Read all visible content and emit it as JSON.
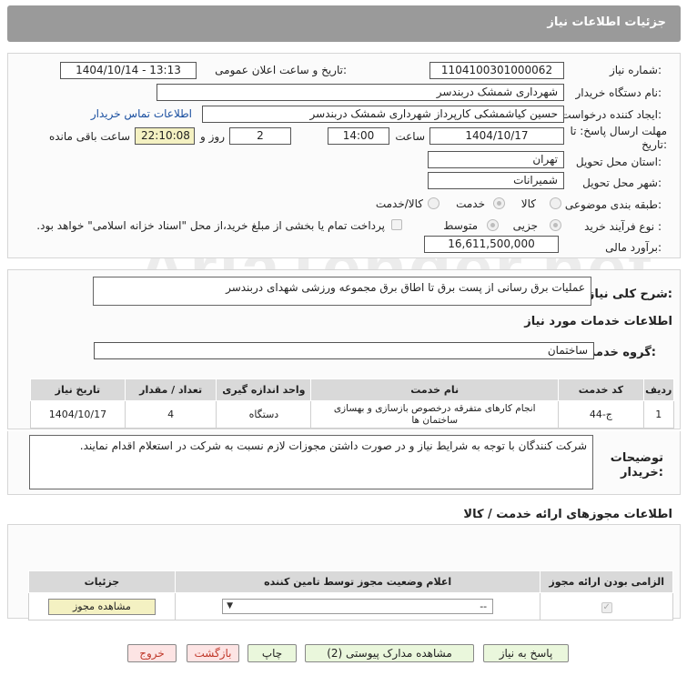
{
  "window": {
    "title": "جزئیات اطلاعات نیاز"
  },
  "watermark": "AriaTender.net",
  "form": {
    "need_number": {
      "label": "شماره نیاز:",
      "value": "1104100301000062"
    },
    "announce": {
      "label": "تاریخ و ساعت اعلان عمومی:",
      "value": "1404/10/14 - 13:13"
    },
    "buyer_org": {
      "label": "نام دستگاه خریدار:",
      "value": "شهرداری شمشک دربندسر"
    },
    "requester": {
      "label": "ایجاد کننده درخواست:",
      "value": "حسین کیاشمشکی کارپرداز شهرداری شمشک دربندسر",
      "contact_link": "اطلاعات تماس خریدار"
    },
    "deadline": {
      "label": "مهلت ارسال پاسخ: تا تاریخ:",
      "date": "1404/10/17",
      "time_label": "ساعت",
      "time": "14:00",
      "days": "2",
      "days_label": "روز و",
      "remaining": "22:10:08",
      "remaining_label": "ساعت باقی مانده"
    },
    "province": {
      "label": "استان محل تحویل:",
      "value": "تهران"
    },
    "city": {
      "label": "شهر محل تحویل:",
      "value": "شمیرانات"
    },
    "category": {
      "label": "طبقه بندی موضوعی:",
      "options": [
        "کالا",
        "خدمت",
        "کالا/خدمت"
      ],
      "selected": 1
    },
    "process": {
      "label": "نوع فرآیند خرید :",
      "options": [
        "جزیی",
        "متوسط"
      ],
      "selected": 0,
      "treasury_note": "پرداخت تمام یا بخشی از مبلغ خرید،از محل \"اسناد خزانه اسلامی\" خواهد بود."
    },
    "estimate": {
      "label": "برآورد مالی:",
      "value": "16,611,500,000"
    }
  },
  "summary": {
    "label": "شرح کلی نیاز:",
    "value": "عملیات برق رسانی از پست برق تا اطاق برق مجموعه ورزشی شهدای دربندسر"
  },
  "services": {
    "section_title": "اطلاعات خدمات مورد نیاز",
    "group_label": "گروه خدمت:",
    "group_value": "ساختمان",
    "columns": [
      "ردیف",
      "کد خدمت",
      "نام خدمت",
      "واحد اندازه گیری",
      "تعداد / مقدار",
      "تاریخ نیاز"
    ],
    "rows": [
      [
        "1",
        "ج-44",
        "انجام کارهای متفرقه درخصوص بازسازی و بهسازی ساختمان ها",
        "دستگاه",
        "4",
        "1404/10/17"
      ]
    ]
  },
  "buyer_notes": {
    "label": "توضیحات خریدار:",
    "value": "شرکت کنندگان با توجه به شرایط نیاز و در صورت داشتن مجوزات لازم  نسبت به شرکت در استعلام اقدام نمایند."
  },
  "permits": {
    "section_title": "اطلاعات مجوزهای ارائه خدمت / کالا",
    "columns": [
      "الزامی بودن ارائه مجوز",
      "اعلام وضعیت مجوز توسط تامین کننده",
      "جزئیات"
    ],
    "select_value": "--",
    "view_button": "مشاهده مجوز"
  },
  "footer_buttons": {
    "reply": "پاسخ به نیاز",
    "docs": "مشاهده مدارک پیوستی (2)",
    "print": "چاپ",
    "back": "بازگشت",
    "exit": "خروج"
  }
}
